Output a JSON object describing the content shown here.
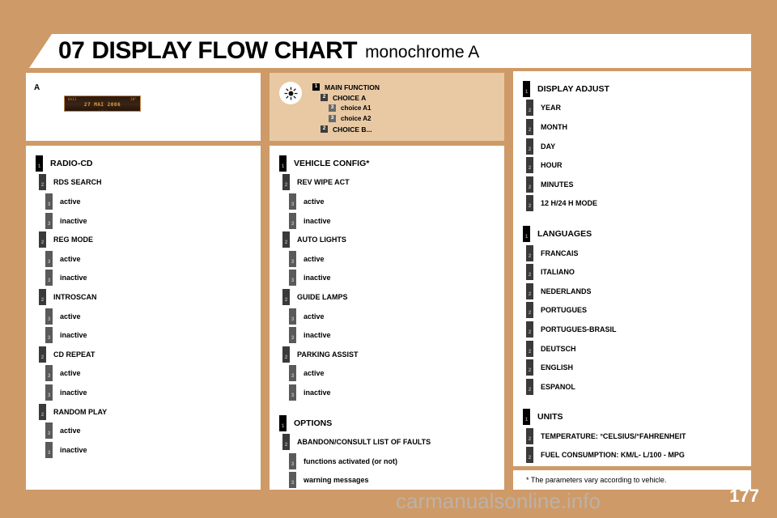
{
  "page": {
    "background_color": "#ce9a67",
    "page_number": "177",
    "watermark": "carmanualsonline.info"
  },
  "header": {
    "chapter_number": "07",
    "title": "DISPLAY FLOW CHART",
    "subtitle": "monochrome A"
  },
  "display_panel": {
    "letter": "A",
    "lcd": {
      "top_left": "8h11",
      "top_right": "20°",
      "main": "27 MAI 2006",
      "bottom": "∙ ∙∙ ∙"
    }
  },
  "legend": {
    "icon": "sun-brightness-icon",
    "lines": [
      {
        "level": 1,
        "badge": "1",
        "text": "MAIN FUNCTION"
      },
      {
        "level": 2,
        "badge": "2",
        "text": "CHOICE A"
      },
      {
        "level": 3,
        "badge": "3",
        "text": "choice A1"
      },
      {
        "level": 3,
        "badge": "3",
        "text": "choice A2"
      },
      {
        "level": 2,
        "badge": "2",
        "text": "CHOICE B..."
      }
    ]
  },
  "columns": {
    "left": [
      {
        "level": 1,
        "badge": "1",
        "label": "RADIO-CD"
      },
      {
        "level": 2,
        "badge": "2",
        "label": "RDS SEARCH"
      },
      {
        "level": 3,
        "badge": "3",
        "label": "active"
      },
      {
        "level": 3,
        "badge": "3",
        "label": "inactive"
      },
      {
        "level": 2,
        "badge": "2",
        "label": "REG MODE"
      },
      {
        "level": 3,
        "badge": "3",
        "label": "active"
      },
      {
        "level": 3,
        "badge": "3",
        "label": "inactive"
      },
      {
        "level": 2,
        "badge": "2",
        "label": "INTROSCAN"
      },
      {
        "level": 3,
        "badge": "3",
        "label": "active"
      },
      {
        "level": 3,
        "badge": "3",
        "label": "inactive"
      },
      {
        "level": 2,
        "badge": "2",
        "label": "CD REPEAT"
      },
      {
        "level": 3,
        "badge": "3",
        "label": "active"
      },
      {
        "level": 3,
        "badge": "3",
        "label": "inactive"
      },
      {
        "level": 2,
        "badge": "2",
        "label": "RANDOM PLAY"
      },
      {
        "level": 3,
        "badge": "3",
        "label": "active"
      },
      {
        "level": 3,
        "badge": "3",
        "label": "inactive"
      }
    ],
    "middle": [
      {
        "level": 1,
        "badge": "1",
        "label": "VEHICLE CONFIG*"
      },
      {
        "level": 2,
        "badge": "2",
        "label": "REV WIPE ACT"
      },
      {
        "level": 3,
        "badge": "3",
        "label": "active"
      },
      {
        "level": 3,
        "badge": "3",
        "label": "inactive"
      },
      {
        "level": 2,
        "badge": "2",
        "label": "AUTO LIGHTS"
      },
      {
        "level": 3,
        "badge": "3",
        "label": "active"
      },
      {
        "level": 3,
        "badge": "3",
        "label": "inactive"
      },
      {
        "level": 2,
        "badge": "2",
        "label": "GUIDE LAMPS"
      },
      {
        "level": 3,
        "badge": "3",
        "label": "active"
      },
      {
        "level": 3,
        "badge": "3",
        "label": "inactive"
      },
      {
        "level": 2,
        "badge": "2",
        "label": "PARKING ASSIST"
      },
      {
        "level": 3,
        "badge": "3",
        "label": "active"
      },
      {
        "level": 3,
        "badge": "3",
        "label": "inactive"
      },
      {
        "level": 0,
        "badge": "",
        "label": ""
      },
      {
        "level": 1,
        "badge": "1",
        "label": "OPTIONS"
      },
      {
        "level": 2,
        "badge": "2",
        "label": "ABANDON/CONSULT LIST OF FAULTS"
      },
      {
        "level": 3,
        "badge": "3",
        "label": "functions activated (or not)"
      },
      {
        "level": 3,
        "badge": "3",
        "label": "warning messages"
      }
    ],
    "right": [
      {
        "level": 1,
        "badge": "1",
        "label": "DISPLAY ADJUST"
      },
      {
        "level": 2,
        "badge": "2",
        "label": "YEAR"
      },
      {
        "level": 2,
        "badge": "2",
        "label": "MONTH"
      },
      {
        "level": 2,
        "badge": "2",
        "label": "DAY"
      },
      {
        "level": 2,
        "badge": "2",
        "label": "HOUR"
      },
      {
        "level": 2,
        "badge": "2",
        "label": "MINUTES"
      },
      {
        "level": 2,
        "badge": "2",
        "label": "12 H/24 H MODE"
      },
      {
        "level": 0,
        "badge": "",
        "label": ""
      },
      {
        "level": 1,
        "badge": "1",
        "label": "LANGUAGES"
      },
      {
        "level": 2,
        "badge": "2",
        "label": "FRANCAIS"
      },
      {
        "level": 2,
        "badge": "2",
        "label": "ITALIANO"
      },
      {
        "level": 2,
        "badge": "2",
        "label": "NEDERLANDS"
      },
      {
        "level": 2,
        "badge": "2",
        "label": "PORTUGUES"
      },
      {
        "level": 2,
        "badge": "2",
        "label": "PORTUGUES-BRASIL"
      },
      {
        "level": 2,
        "badge": "2",
        "label": "DEUTSCH"
      },
      {
        "level": 2,
        "badge": "2",
        "label": "ENGLISH"
      },
      {
        "level": 2,
        "badge": "2",
        "label": "ESPANOL"
      },
      {
        "level": 0,
        "badge": "",
        "label": ""
      },
      {
        "level": 1,
        "badge": "1",
        "label": "UNITS"
      },
      {
        "level": 2,
        "badge": "2",
        "label": "TEMPERATURE: °CELSIUS/°FAHRENHEIT"
      },
      {
        "level": 2,
        "badge": "2",
        "label": "FUEL CONSUMPTION: KM/L- L/100 - MPG"
      }
    ]
  },
  "footnote": {
    "text": "* The parameters vary according to vehicle."
  }
}
